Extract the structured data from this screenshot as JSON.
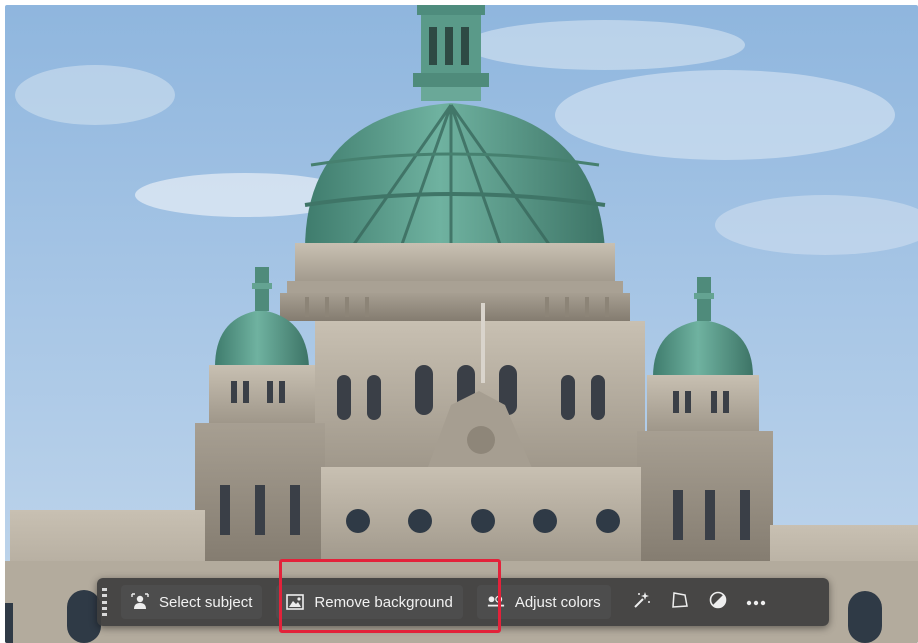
{
  "toolbar": {
    "select_subject_label": "Select subject",
    "remove_background_label": "Remove background",
    "adjust_colors_label": "Adjust colors",
    "icons": [
      "grip-icon",
      "person-select-icon",
      "image-remove-bg-icon",
      "adjust-colors-icon",
      "sparkle-wand-icon",
      "transform-icon",
      "contrast-circle-icon",
      "more-dots-icon"
    ]
  },
  "colors": {
    "taskbar_bg": "#3e3e3e",
    "button_bg": "#4d4d4d",
    "highlight": "#e3223a",
    "dome_copper": "#5e9b8a",
    "stone": "#b9b1a3",
    "sky": "#a6c5e4"
  }
}
